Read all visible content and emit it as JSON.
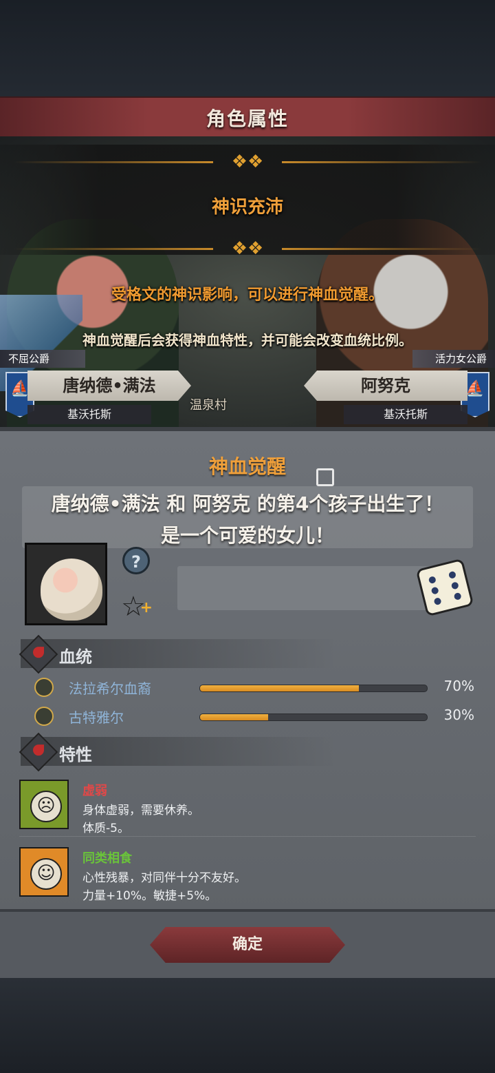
{
  "header": {
    "title": "角色属性"
  },
  "event": {
    "status": "神识充沛",
    "description_line1": "受格文的神识影响，可以进行神血觉醒。",
    "description_line2": "神血觉醒后会获得神血特性，并可能会改变血统比例。"
  },
  "parents": {
    "left": {
      "title": "不屈公爵",
      "name": "唐纳德•满法",
      "realm": "基沃托斯",
      "flag_icon": "ship-icon"
    },
    "right": {
      "title": "活力女公爵",
      "name": "阿努克",
      "realm": "基沃托斯",
      "flag_icon": "ship-icon"
    },
    "village": "温泉村"
  },
  "awakening": {
    "label": "神血觉醒",
    "checked": false
  },
  "birth": {
    "line1": "唐纳德•满法 和 阿努克 的第4个孩子出生了！",
    "line2": "是一个可爱的女儿！"
  },
  "lineage": {
    "title": "血统",
    "items": [
      {
        "name": "法拉希尔血裔",
        "percent": 70,
        "label": "70%"
      },
      {
        "name": "古特雅尔",
        "percent": 30,
        "label": "30%"
      }
    ]
  },
  "traits": {
    "title": "特性",
    "items": [
      {
        "name": "虚弱",
        "name_color": "#e04848",
        "desc": "身体虚弱，需要休养。",
        "effect": "体质-5。",
        "face": "☹",
        "bg": "#7a9a2a"
      },
      {
        "name": "同类相食",
        "name_color": "#6ac43a",
        "desc": "心性残暴，对同伴十分不友好。",
        "effect": "力量+10%。敏捷+5%。",
        "face": "☺",
        "bg": "#e08a28"
      }
    ]
  },
  "footer": {
    "confirm_label": "确定"
  }
}
